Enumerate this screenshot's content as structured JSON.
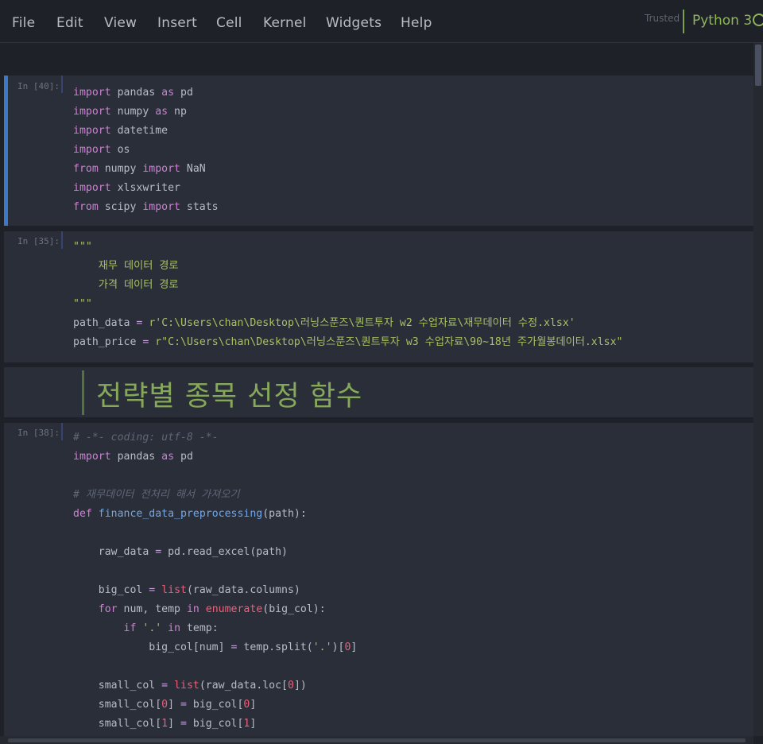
{
  "menubar": {
    "items": [
      "File",
      "Edit",
      "View",
      "Insert",
      "Cell",
      "Kernel",
      "Widgets",
      "Help"
    ],
    "trusted": "Trusted",
    "kernel": "Python 3"
  },
  "cells": {
    "c1": {
      "prompt": "In [40]:"
    },
    "c2": {
      "prompt": "In [35]:"
    },
    "c3": {
      "prompt": "In [38]:"
    }
  },
  "markdown": {
    "heading": "전략별 종목 선정 함수"
  },
  "colors": {
    "background": "#1f2128",
    "cell": "#2a2e38",
    "selected_border": "#3b78c9",
    "keyword": "#d07fd6",
    "string": "#a8c064",
    "comment": "#5f6679",
    "function": "#6fa6e8",
    "kernel_green": "#8fb55a"
  },
  "icons": [
    "kernel-idle-icon"
  ]
}
